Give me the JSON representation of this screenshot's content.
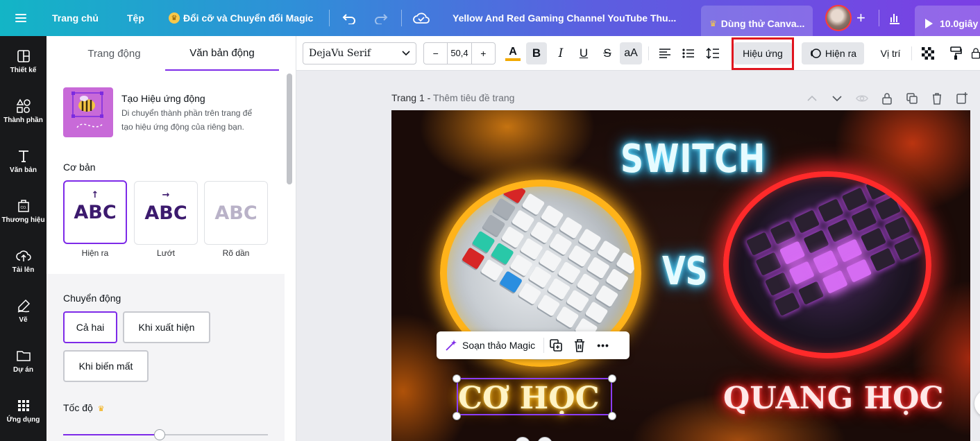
{
  "topbar": {
    "home": "Trang chủ",
    "file": "Tệp",
    "magic": "Đổi cỡ và Chuyển đổi Magic",
    "doc_title": "Yellow And Red Gaming Channel YouTube Thu...",
    "try_canva": "Dùng thử Canva...",
    "play_time": "10.0giây"
  },
  "sidebar": {
    "items": [
      {
        "label": "Thiết kế",
        "icon": "layout-icon"
      },
      {
        "label": "Thành phần",
        "icon": "shapes-icon"
      },
      {
        "label": "Văn bản",
        "icon": "text-icon"
      },
      {
        "label": "Thương hiệu",
        "icon": "brand-icon"
      },
      {
        "label": "Tải lên",
        "icon": "upload-icon"
      },
      {
        "label": "Vẽ",
        "icon": "draw-icon"
      },
      {
        "label": "Dự án",
        "icon": "folder-icon"
      },
      {
        "label": "Ứng dụng",
        "icon": "apps-icon"
      }
    ]
  },
  "panel": {
    "tabs": [
      "Trang động",
      "Văn bản động"
    ],
    "active_tab": 1,
    "feature_title": "Tạo Hiệu ứng động",
    "feature_desc_1": "Di chuyển thành phần trên trang để",
    "feature_desc_2": "tạo hiệu ứng động của riêng bạn.",
    "basic_title": "Cơ bản",
    "animations": [
      {
        "text": "ABC",
        "label": "Hiện ra",
        "arrow": "↑"
      },
      {
        "text": "ABC",
        "label": "Lướt",
        "arrow": "→"
      },
      {
        "text": "ABC",
        "label": "Rõ dần",
        "arrow": ""
      }
    ],
    "motion_title": "Chuyển động",
    "motion_options": [
      "Cả hai",
      "Khi xuất hiện",
      "Khi biến mất"
    ],
    "speed_title": "Tốc độ",
    "speed_value": 0.47
  },
  "toolbar": {
    "font": "DejaVu Serif",
    "font_size": "50,4",
    "minus": "−",
    "plus": "+",
    "text_color_glyph": "A",
    "bold": "B",
    "italic": "I",
    "underline": "U",
    "strike": "S",
    "case": "aA",
    "effects": "Hiệu ứng",
    "animate": "Hiện ra",
    "position": "Vị trí"
  },
  "canvas": {
    "page_label": "Trang 1 - ",
    "page_title_placeholder": "Thêm tiêu đề trang",
    "design": {
      "switch": "SWITCH",
      "vs": "VS",
      "left_caption": "CƠ HỌC",
      "right_caption": "QUANG HỌC"
    },
    "context_menu": {
      "magic_write": "Soạn thảo Magic",
      "more": "•••"
    }
  },
  "colors": {
    "accent": "#7d2ae8",
    "highlight": "#e0141e"
  }
}
